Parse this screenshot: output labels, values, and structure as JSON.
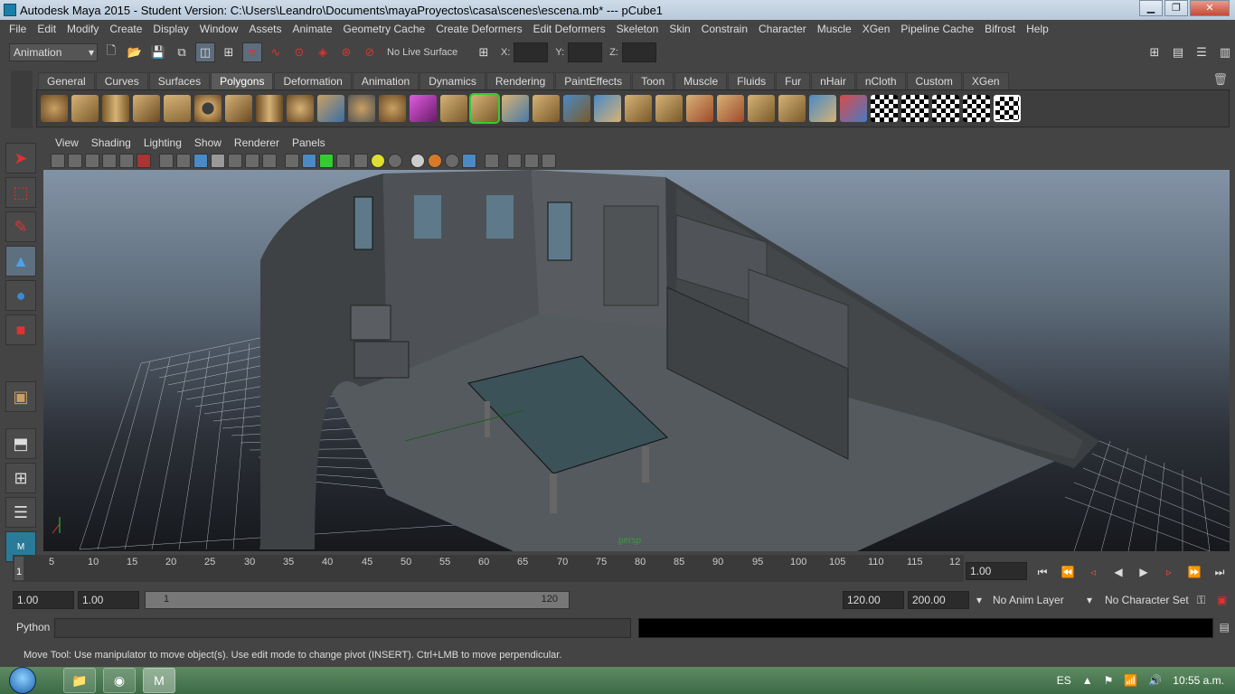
{
  "window": {
    "title": "Autodesk Maya 2015 - Student Version: C:\\Users\\Leandro\\Documents\\mayaProyectos\\casa\\scenes\\escena.mb*   ---   pCube1"
  },
  "menubar": {
    "items": [
      "File",
      "Edit",
      "Modify",
      "Create",
      "Display",
      "Window",
      "Assets",
      "Animate",
      "Geometry Cache",
      "Create Deformers",
      "Edit Deformers",
      "Skeleton",
      "Skin",
      "Constrain",
      "Character",
      "Muscle",
      "XGen",
      "Pipeline Cache",
      "Bifrost",
      "Help"
    ]
  },
  "statusline": {
    "mode": "Animation",
    "live_surface": "No Live Surface",
    "x_label": "X:",
    "y_label": "Y:",
    "z_label": "Z:"
  },
  "shelf": {
    "tabs": [
      "General",
      "Curves",
      "Surfaces",
      "Polygons",
      "Deformation",
      "Animation",
      "Dynamics",
      "Rendering",
      "PaintEffects",
      "Toon",
      "Muscle",
      "Fluids",
      "Fur",
      "nHair",
      "nCloth",
      "Custom",
      "XGen"
    ],
    "active_tab": "Polygons"
  },
  "panel": {
    "menus": [
      "View",
      "Shading",
      "Lighting",
      "Show",
      "Renderer",
      "Panels"
    ],
    "camera": "persp"
  },
  "timeline": {
    "ticks": [
      "5",
      "10",
      "15",
      "20",
      "25",
      "30",
      "35",
      "40",
      "45",
      "50",
      "55",
      "60",
      "65",
      "70",
      "75",
      "80",
      "85",
      "90",
      "95",
      "100",
      "105",
      "110",
      "115",
      "12"
    ],
    "current_marker": "1",
    "current_frame": "1.00"
  },
  "range": {
    "start_time": "1.00",
    "start_playback": "1.00",
    "range_start": "1",
    "range_end": "120",
    "end_playback": "120.00",
    "end_time": "200.00",
    "anim_layer": "No Anim Layer",
    "character_set": "No Character Set"
  },
  "command": {
    "label": "Python"
  },
  "helpline": {
    "text": "Move Tool: Use manipulator to move object(s). Use edit mode to change pivot (INSERT).  Ctrl+LMB to move perpendicular."
  },
  "taskbar": {
    "language": "ES",
    "time": "10:55 a.m."
  }
}
